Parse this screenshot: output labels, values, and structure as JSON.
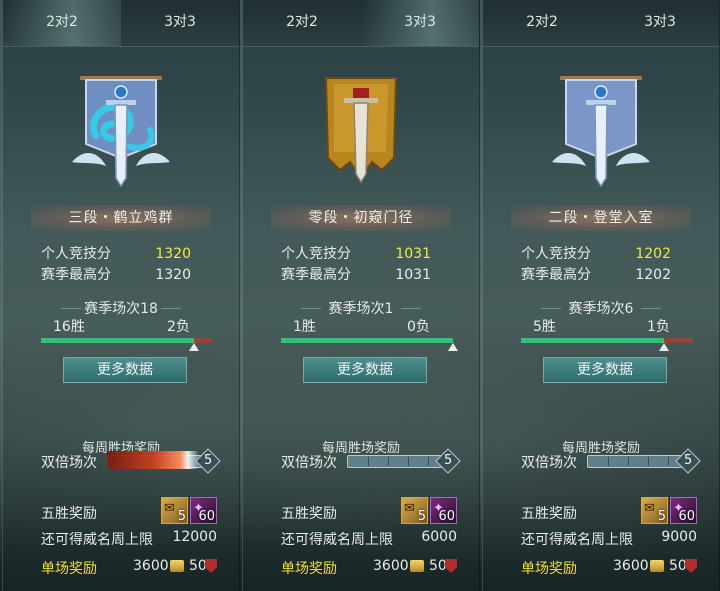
{
  "panels": [
    {
      "tabs": [
        "2对2",
        "3对3"
      ],
      "active_tab": 0,
      "emblem": "blue-dragon-banner",
      "rank": "三段・鹤立鸡群",
      "score_label": "个人竞技分",
      "score": "1320",
      "best_label": "赛季最高分",
      "best": "1320",
      "season_label": "赛季场次18",
      "wins": "16胜",
      "losses": "2负",
      "win_fraction": 0.889,
      "more_button": "更多数据",
      "weekly_title": "每周胜场奖励",
      "double_label": "双倍场次",
      "double_count": "5",
      "double_active": true,
      "five_win_label": "五胜奖励",
      "item1_count": "5",
      "item2_count": "60",
      "limit_label": "还可得威名周上限",
      "limit_value": "12000",
      "single_label": "单场奖励",
      "single_coin": "3600",
      "single_medal": "50"
    },
    {
      "tabs": [
        "2对2",
        "3对3"
      ],
      "active_tab": 1,
      "emblem": "gold-sword-banner",
      "rank": "零段・初窥门径",
      "score_label": "个人竞技分",
      "score": "1031",
      "best_label": "赛季最高分",
      "best": "1031",
      "season_label": "赛季场次1",
      "wins": "1胜",
      "losses": "0负",
      "win_fraction": 1.0,
      "more_button": "更多数据",
      "weekly_title": "每周胜场奖励",
      "double_label": "双倍场次",
      "double_count": "5",
      "double_active": false,
      "five_win_label": "五胜奖励",
      "item1_count": "5",
      "item2_count": "60",
      "limit_label": "还可得威名周上限",
      "limit_value": "6000",
      "single_label": "单场奖励",
      "single_coin": "3600",
      "single_medal": "50"
    },
    {
      "tabs": [
        "2对2",
        "3对3"
      ],
      "active_tab": -1,
      "emblem": "silver-sword-banner",
      "rank": "二段・登堂入室",
      "score_label": "个人竞技分",
      "score": "1202",
      "best_label": "赛季最高分",
      "best": "1202",
      "season_label": "赛季场次6",
      "wins": "5胜",
      "losses": "1负",
      "win_fraction": 0.833,
      "more_button": "更多数据",
      "weekly_title": "每周胜场奖励",
      "double_label": "双倍场次",
      "double_count": "5",
      "double_active": false,
      "five_win_label": "五胜奖励",
      "item1_count": "5",
      "item2_count": "60",
      "limit_label": "还可得威名周上限",
      "limit_value": "9000",
      "single_label": "单场奖励",
      "single_coin": "3600",
      "single_medal": "50"
    }
  ],
  "colors": {
    "score_highlight": "#f3ea3c",
    "single_label": "#f2df39",
    "win_bar": "#3bbd79",
    "loss_bar": "#8d4a33"
  }
}
